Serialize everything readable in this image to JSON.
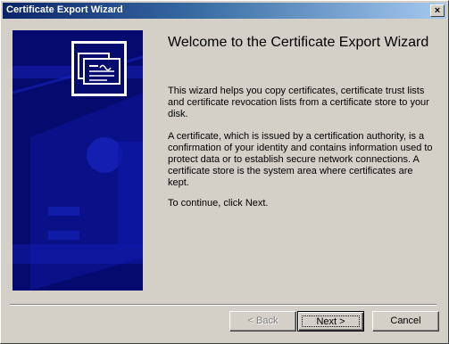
{
  "window": {
    "title": "Certificate Export Wizard",
    "close_label": "×"
  },
  "page": {
    "heading": "Welcome to the Certificate Export Wizard",
    "paragraph_1": "This wizard helps you copy certificates, certificate trust lists and certificate revocation lists from a certificate store to your disk.",
    "paragraph_2": "A certificate, which is issued by a certification authority, is a confirmation of your identity and contains information used to protect data or to establish secure network connections. A certificate store is the system area where certificates are kept.",
    "paragraph_3": "To continue, click Next."
  },
  "buttons": {
    "back": "< Back",
    "next": "Next >",
    "cancel": "Cancel"
  },
  "icons": {
    "banner": "certificate-icon",
    "close": "close-icon"
  },
  "colors": {
    "titlebar_start": "#0a246a",
    "titlebar_end": "#a6caf0",
    "banner_bg": "#050a6e",
    "dialog_bg": "#d4d0c8"
  }
}
